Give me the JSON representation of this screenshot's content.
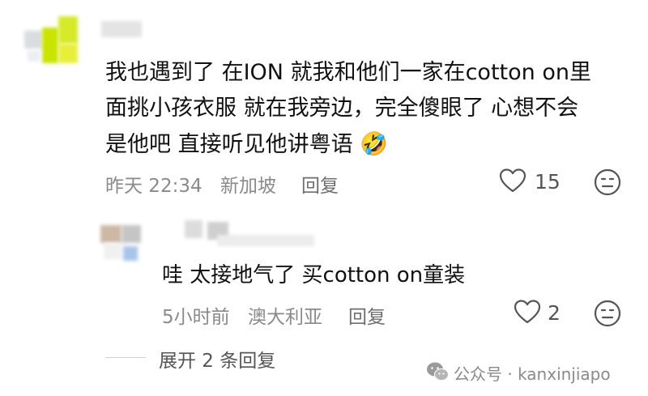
{
  "comment": {
    "lines": [
      "我也遇到了 在ION 就我和他们一家在cotton on里",
      "面挑小孩衣服 就在我旁边，完全傻眼了 心想不会",
      "是他吧 直接听见他讲粤语"
    ],
    "emoji": "🤣",
    "date": "昨天 22:34",
    "location": "新加坡",
    "reply_label": "回复",
    "like_count": "15"
  },
  "reply": {
    "text": "哇 太接地气了 买cotton on童装",
    "time": "5小时前",
    "location": "澳大利亚",
    "reply_label": "回复",
    "like_count": "2"
  },
  "expand": {
    "label": "展开 2 条回复"
  },
  "watermark": {
    "text": "公众号 · kanxinjiapo"
  },
  "colors": {
    "avatar_lime": "#c9e400",
    "avatar_yellow": "#e8ef3a",
    "text": "#111111",
    "meta": "#8a8a8a"
  }
}
